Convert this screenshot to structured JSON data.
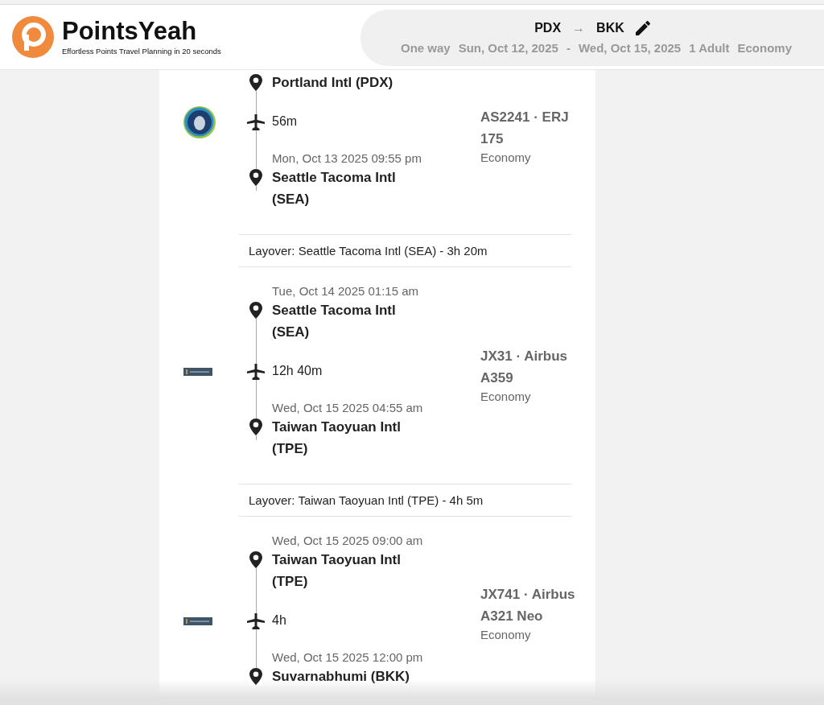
{
  "header": {
    "brand": "PointsYeah",
    "tagline": "Effortless Points Travel Planning in 20 seconds",
    "route": {
      "from": "PDX",
      "arrow": "→",
      "to": "BKK"
    },
    "details": [
      "One way",
      "Sun, Oct 12, 2025",
      "-",
      "Wed, Oct 15, 2025",
      "1 Adult",
      "Economy"
    ]
  },
  "itinerary": [
    {
      "kind": "segment",
      "airline_logo": {
        "kind": "round"
      },
      "departure_airport": "Portland Intl (PDX)",
      "duration": "56m",
      "arrival_time": "Mon, Oct 13 2025 09:55 pm",
      "arrival_airport": "Seattle Tacoma Intl (SEA)",
      "flight": "AS2241 · ERJ 175",
      "cabin": "Economy"
    },
    {
      "kind": "layover",
      "text": "Layover: Seattle Tacoma Intl (SEA) - 3h 20m"
    },
    {
      "kind": "segment",
      "airline_logo": {
        "kind": "banner"
      },
      "departure_time": "Tue, Oct 14 2025 01:15 am",
      "departure_airport": "Seattle Tacoma Intl (SEA)",
      "duration": "12h 40m",
      "arrival_time": "Wed, Oct 15 2025 04:55 am",
      "arrival_airport": "Taiwan Taoyuan Intl (TPE)",
      "flight": "JX31 · Airbus A359",
      "cabin": "Economy"
    },
    {
      "kind": "layover",
      "text": "Layover: Taiwan Taoyuan Intl (TPE) - 4h 5m"
    },
    {
      "kind": "segment",
      "airline_logo": {
        "kind": "banner"
      },
      "departure_time": "Wed, Oct 15 2025 09:00 am",
      "departure_airport": "Taiwan Taoyuan Intl (TPE)",
      "duration": "4h",
      "arrival_time": "Wed, Oct 15 2025 12:00 pm",
      "arrival_airport": "Suvarnabhumi (BKK)",
      "flight": "JX741 · Airbus A321 Neo",
      "cabin": "Economy"
    }
  ]
}
